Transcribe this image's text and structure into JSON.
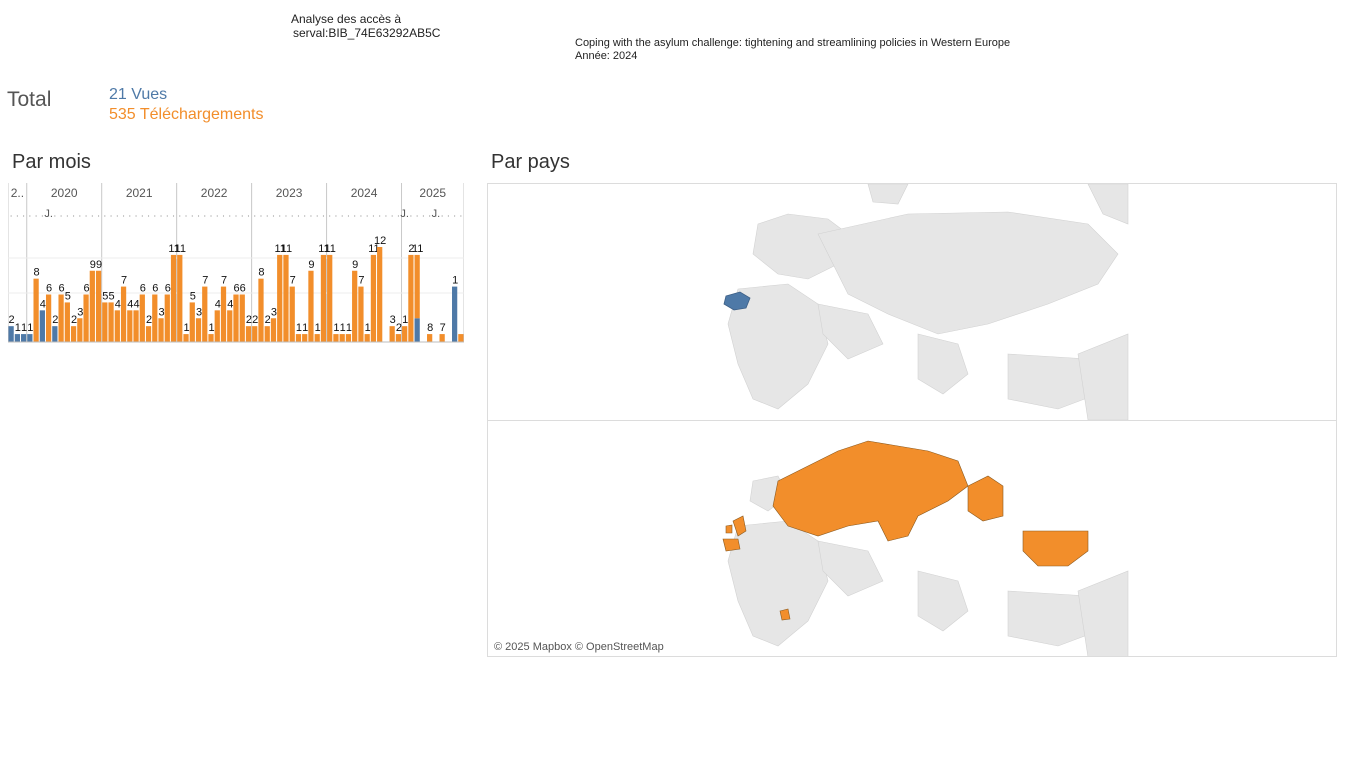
{
  "header": {
    "title_line1": "Analyse des accès à",
    "title_line2": "serval:BIB_74E63292AB5C",
    "doc_title": "Coping with the asylum challenge: tightening and streamlining policies in Western Europe",
    "doc_year": "Année: 2024"
  },
  "totals": {
    "label": "Total",
    "views": "21 Vues",
    "downloads": "535 Téléchargements"
  },
  "sections": {
    "by_month": "Par mois",
    "by_country": "Par pays"
  },
  "colors": {
    "views": "#4e79a7",
    "downloads": "#f28e2b",
    "land": "#e6e6e6",
    "ocean": "#ffffff"
  },
  "chart_data": {
    "type": "bar",
    "stacked": true,
    "year_labels": [
      "2..",
      "2020",
      "2021",
      "2022",
      "2023",
      "2024",
      "2025"
    ],
    "month_markers": [
      "J.",
      "J.",
      "J."
    ],
    "series": [
      {
        "name": "Vues",
        "values": [
          2,
          1,
          1,
          1,
          0,
          4,
          0,
          2,
          0,
          0,
          0,
          0,
          0,
          0,
          0,
          0,
          0,
          0,
          0,
          0,
          0,
          0,
          0,
          0,
          0,
          0,
          0,
          0,
          0,
          0,
          0,
          0,
          0,
          0,
          0,
          0,
          0,
          0,
          0,
          0,
          0,
          0,
          0,
          0,
          0,
          0,
          0,
          0,
          0,
          0,
          0,
          0,
          0,
          0,
          0,
          0,
          0,
          0,
          0,
          0,
          0,
          0,
          0,
          0,
          0,
          3,
          0,
          0,
          0,
          0,
          0,
          7,
          0
        ]
      },
      {
        "name": "Téléchargements",
        "values": [
          0,
          0,
          0,
          0,
          8,
          0,
          6,
          0,
          6,
          5,
          2,
          3,
          6,
          9,
          9,
          5,
          5,
          4,
          7,
          4,
          4,
          6,
          2,
          6,
          3,
          6,
          11,
          11,
          1,
          5,
          3,
          7,
          1,
          4,
          7,
          4,
          6,
          6,
          2,
          2,
          8,
          2,
          3,
          11,
          11,
          7,
          1,
          1,
          9,
          1,
          11,
          11,
          1,
          1,
          1,
          9,
          7,
          1,
          11,
          12,
          0,
          2,
          1,
          2,
          11,
          8,
          0,
          1,
          0,
          1,
          0,
          0,
          1
        ]
      }
    ],
    "bar_labels": [
      "2",
      "1",
      "1",
      "1",
      "8",
      "4",
      "6",
      "2",
      "6",
      "5",
      "2",
      "3",
      "6",
      "9",
      "9",
      "5",
      "5",
      "4",
      "7",
      "4",
      "4",
      "6",
      "2",
      "6",
      "3",
      "6",
      "11",
      "11",
      "1",
      "5",
      "3",
      "7",
      "1",
      "4",
      "7",
      "4",
      "6",
      "6",
      "2",
      "2",
      "8",
      "2",
      "3",
      "11",
      "11",
      "7",
      "1",
      "1",
      "9",
      "1",
      "11",
      "11",
      "1",
      "1",
      "1",
      "9",
      "7",
      "1",
      "11",
      "12",
      "3",
      "2",
      "1",
      "2",
      "11",
      "8",
      "7",
      "1"
    ]
  },
  "map": {
    "attribution": "© 2025 Mapbox © OpenStreetMap",
    "views_countries": [
      "France"
    ],
    "download_countries": [
      "Russia",
      "United Kingdom",
      "Ireland",
      "Portugal",
      "Spain",
      "Switzerland",
      "United States",
      "Alaska",
      "Zambia"
    ]
  }
}
